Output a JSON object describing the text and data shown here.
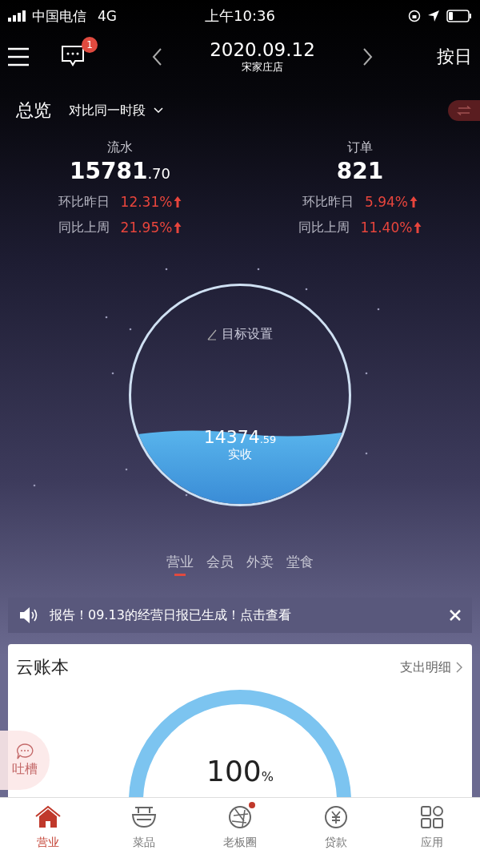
{
  "status_bar": {
    "carrier": "中国电信",
    "network": "4G",
    "time": "上午10:36"
  },
  "header": {
    "badge": "1",
    "date": "2020.09.12",
    "store": "宋家庄店",
    "mode": "按日"
  },
  "overview": {
    "title": "总览",
    "compare": "对比同一时段"
  },
  "metrics": [
    {
      "label": "流水",
      "value": "15781",
      "fraction": ".70",
      "rates": [
        {
          "label": "环比昨日",
          "value": "12.31%"
        },
        {
          "label": "同比上周",
          "value": "21.95%"
        }
      ]
    },
    {
      "label": "订单",
      "value": "821",
      "rates": [
        {
          "label": "环比昨日",
          "value": "5.94%"
        },
        {
          "label": "同比上周",
          "value": "11.40%"
        }
      ]
    }
  ],
  "goal": {
    "setting": "目标设置",
    "value": "14374",
    "fraction": ".59",
    "caption": "实收"
  },
  "tabs": [
    {
      "label": "营业",
      "selected": true
    },
    {
      "label": "会员",
      "selected": false
    },
    {
      "label": "外卖",
      "selected": false
    },
    {
      "label": "堂食",
      "selected": false
    }
  ],
  "notice": {
    "text": "报告！09.13的经营日报已生成！点击查看"
  },
  "ledger": {
    "title": "云账本",
    "link": "支出明细",
    "percent": "100",
    "unit": "%"
  },
  "feedback": {
    "label": "吐槽"
  },
  "nav": [
    {
      "label": "营业",
      "selected": true,
      "dot": false
    },
    {
      "label": "菜品",
      "selected": false,
      "dot": false
    },
    {
      "label": "老板圈",
      "selected": false,
      "dot": true
    },
    {
      "label": "贷款",
      "selected": false,
      "dot": false
    },
    {
      "label": "应用",
      "selected": false,
      "dot": false
    }
  ]
}
